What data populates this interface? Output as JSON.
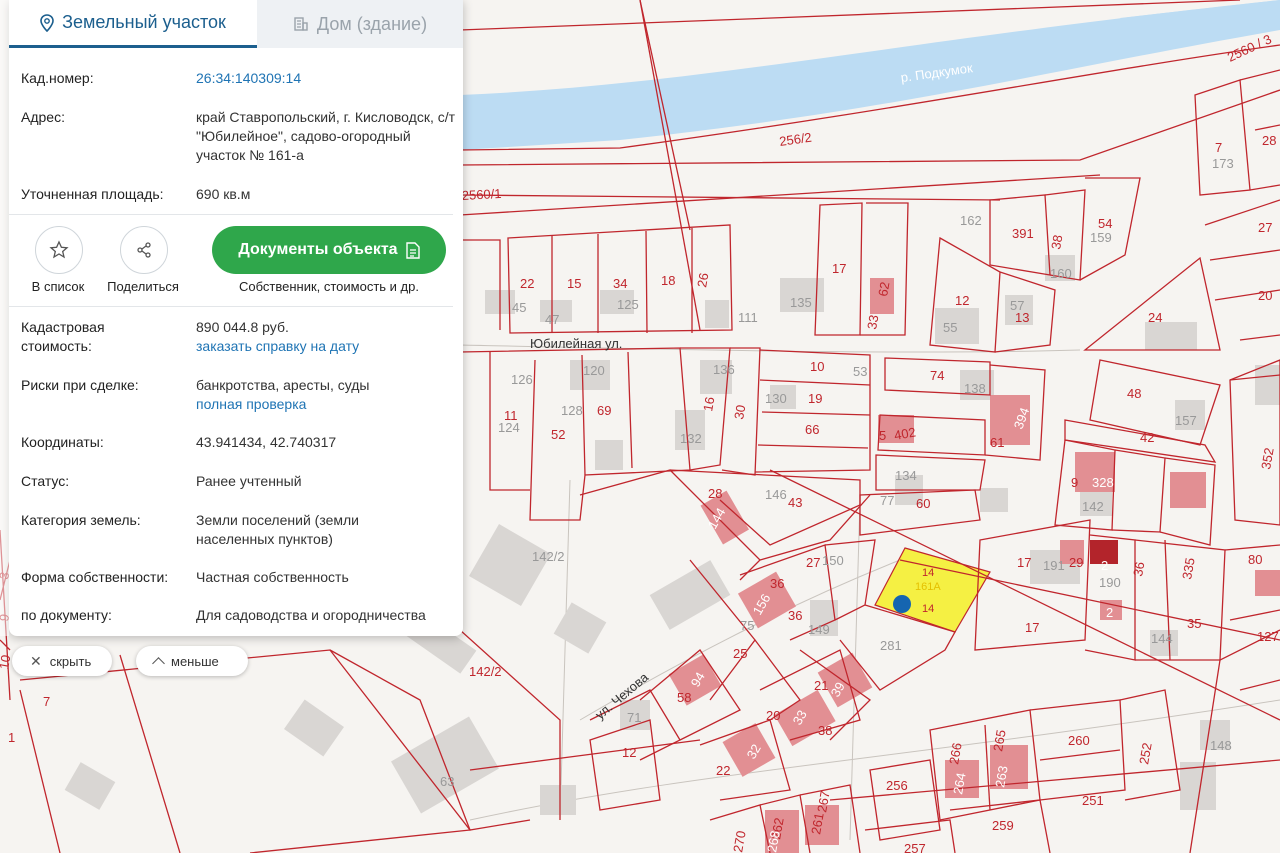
{
  "tabs": {
    "land": "Земельный участок",
    "house": "Дом (здание)"
  },
  "info": {
    "cad_label": "Кад.номер:",
    "cad_value": "26:34:140309:14",
    "address_label": "Адрес:",
    "address_value": "край Ставропольский, г. Кисловодск, с/т \"Юбилейное\", садово-огородный участок № 161-а",
    "area_label": "Уточненная площадь:",
    "area_value": "690 кв.м"
  },
  "actions": {
    "list": "В список",
    "share": "Поделиться",
    "docs_button": "Документы объекта",
    "docs_sub": "Собственник, стоимость и др."
  },
  "details": {
    "cost_label": "Кадастровая стоимость:",
    "cost_value": "890 044.8 руб.",
    "cost_link": "заказать справку на дату",
    "risk_label": "Риски при сделке:",
    "risk_value": "банкротства, аресты, суды",
    "risk_link": "полная проверка",
    "coord_label": "Координаты:",
    "coord_value": "43.941434, 42.740317",
    "status_label": "Статус:",
    "status_value": "Ранее учтенный",
    "cat_label": "Категория земель:",
    "cat_value": "Земли поселений (земли населенных пунктов)",
    "own_label": "Форма собственности:",
    "own_value": "Частная собственность",
    "doc_label": "по документу:",
    "doc_value": "Для садоводства и огородничества"
  },
  "controls": {
    "hide": "скрыть",
    "less": "меньше"
  },
  "map": {
    "river": "р. Подкумок",
    "street_jubilee": "Юбилейная ул.",
    "street_chekhov": "ул. Чехова",
    "selected_parcel": [
      "14",
      "161А",
      "14"
    ],
    "labels": [
      "2560 / 3",
      "256/2",
      "2560/1",
      "22",
      "15",
      "34",
      "18",
      "26",
      "17",
      "62",
      "33",
      "12",
      "57",
      "13",
      "55",
      "391",
      "38",
      "54",
      "159",
      "160",
      "162",
      "7",
      "173",
      "28",
      "27",
      "20",
      "24",
      "45",
      "47",
      "125",
      "111",
      "135",
      "126",
      "120",
      "136",
      "10",
      "53",
      "74",
      "138",
      "130",
      "19",
      "11",
      "124",
      "128",
      "69",
      "52",
      "16",
      "30",
      "66",
      "5",
      "402",
      "61",
      "394",
      "48",
      "42",
      "157",
      "132",
      "9",
      "328",
      "142",
      "134",
      "77",
      "60",
      "146",
      "43",
      "28",
      "144",
      "142/2",
      "27",
      "150",
      "17",
      "191",
      "29",
      "2",
      "190",
      "36",
      "335",
      "80",
      "36",
      "156",
      "36",
      "149",
      "75",
      "25",
      "17",
      "144",
      "35",
      "127",
      "2",
      "281",
      "142/2",
      "7",
      "58",
      "94",
      "21",
      "39",
      "71",
      "20",
      "33",
      "38",
      "12",
      "22",
      "32",
      "266",
      "265",
      "264",
      "263",
      "260",
      "252",
      "148",
      "63",
      "256",
      "251",
      "262",
      "261",
      "267",
      "268",
      "270",
      "257",
      "259",
      "352",
      "3",
      "9",
      "10",
      "1"
    ]
  },
  "colors": {
    "parcel_line": "#c0262d",
    "river": "#bcdcf3",
    "selected": "#f5f043",
    "accent": "#1c5f8e",
    "green": "#2fa74b"
  }
}
